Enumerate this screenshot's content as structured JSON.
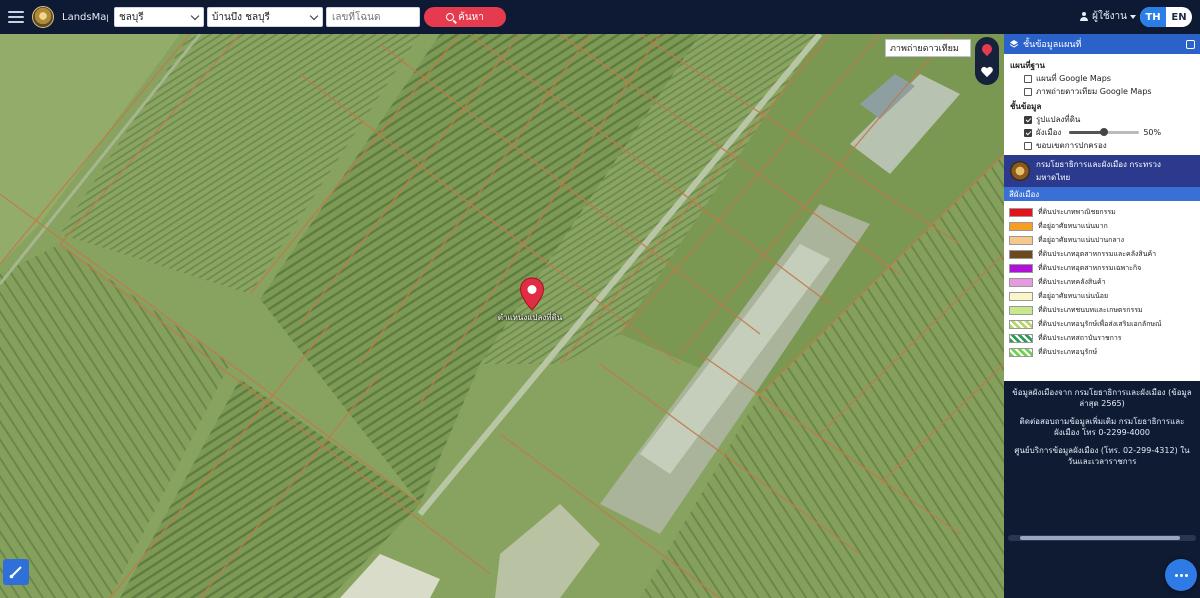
{
  "header": {
    "app_name": "LandsMaps",
    "province_select": "ชลบุรี",
    "district_select": "บ้านบึง ชลบุรี",
    "parcel_placeholder": "เลขที่โฉนด",
    "search_label": "ค้นหา",
    "user_label": "ผู้ใช้งาน",
    "lang_th": "TH",
    "lang_en": "EN"
  },
  "map": {
    "basemap_label": "ภาพถ่ายดาวเทียม",
    "marker_label": "ตำแหน่งแปลงที่ดิน",
    "colors": {
      "field": "#86a05c",
      "field_dark": "#6f8b4c",
      "boundary": "#c07a4a",
      "road": "#b9c6a6",
      "marker": "#e02d43"
    }
  },
  "panel": {
    "title": "ชั้นข้อมูลแผนที่",
    "groups": [
      {
        "title": "แผนที่ฐาน",
        "items": [
          {
            "label": "แผนที่ Google Maps",
            "checked": false
          },
          {
            "label": "ภาพถ่ายดาวเทียม Google Maps",
            "checked": false
          }
        ]
      },
      {
        "title": "ชั้นข้อมูล",
        "items": [
          {
            "label": "รูปแปลงที่ดิน",
            "checked": true
          },
          {
            "label": "ผังเมือง",
            "checked": true,
            "opacity": "50%"
          },
          {
            "label": "ขอบเขตการปกครอง",
            "checked": false
          }
        ]
      }
    ],
    "agency": "กรมโยธาธิการและผังเมือง กระทรวงมหาดไทย",
    "legend_title": "สีผังเมือง",
    "legend": [
      {
        "label": "ที่ดินประเภทพาณิชยกรรม",
        "color": "#e3121b"
      },
      {
        "label": "ที่อยู่อาศัยหนาแน่นมาก",
        "color": "#f5a020"
      },
      {
        "label": "ที่อยู่อาศัยหนาแน่นปานกลาง",
        "color": "#f7c88a"
      },
      {
        "label": "ที่ดินประเภทอุตสาหกรรมและคลังสินค้า",
        "color": "#6b4a1e"
      },
      {
        "label": "ที่ดินประเภทอุตสาหกรรมเฉพาะกิจ",
        "color": "#b010d8"
      },
      {
        "label": "ที่ดินประเภทคลังสินค้า",
        "color": "#e89ae0"
      },
      {
        "label": "ที่อยู่อาศัยหนาแน่นน้อย",
        "color": "#fbf6c8"
      },
      {
        "label": "ที่ดินประเภทชนบทและเกษตรกรรม",
        "color": "#c9e88a"
      },
      {
        "label": "ที่ดินประเภทอนุรักษ์เพื่อส่งเสริมเอกลักษณ์",
        "color": "#b7d66a"
      },
      {
        "label": "ที่ดินประเภทสถาบันราชการ",
        "color": "#2e9a5a"
      },
      {
        "label": "ที่ดินประเภทอนุรักษ์",
        "color": "#6ed24a"
      }
    ],
    "info": [
      "ข้อมูลผังเมืองจาก กรมโยธาธิการและผังเมือง (ข้อมูลล่าสุด 2565)",
      "ติดต่อสอบถามข้อมูลเพิ่มเติม กรมโยธาธิการและผังเมือง โทร 0-2299-4000",
      "ศูนย์บริการข้อมูลผังเมือง (โทร. 02-299-4312) ในวันและเวลาราชการ"
    ]
  }
}
